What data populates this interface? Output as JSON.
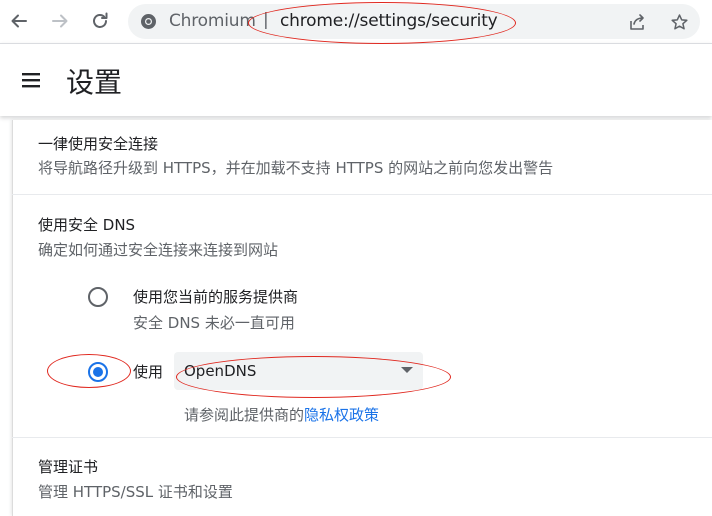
{
  "browser": {
    "origin_label": "Chromium",
    "separator": "|",
    "url": "chrome://settings/security",
    "icons": {
      "back": "arrow-left-icon",
      "forward": "arrow-right-icon",
      "reload": "reload-icon",
      "site": "chromium-site-icon",
      "share": "share-icon",
      "bookmark": "star-icon"
    }
  },
  "header": {
    "menu_icon": "hamburger-menu-icon",
    "title": "设置"
  },
  "sections": {
    "https": {
      "title": "一律使用安全连接",
      "subtitle": "将导航路径升级到 HTTPS，并在加载不支持 HTTPS 的网站之前向您发出警告"
    },
    "secure_dns": {
      "title": "使用安全 DNS",
      "subtitle": "确定如何通过安全连接来连接到网站",
      "option_current": {
        "label": "使用您当前的服务提供商",
        "sublabel": "安全 DNS 未必一直可用",
        "selected": false
      },
      "option_custom": {
        "label": "使用",
        "selected": true,
        "provider": "OpenDNS",
        "privacy_prefix": "请参阅此提供商的",
        "privacy_link": "隐私权政策"
      }
    },
    "certificates": {
      "title": "管理证书",
      "subtitle": "管理 HTTPS/SSL 证书和设置"
    }
  },
  "colors": {
    "accent": "#1a73e8",
    "annotation": "#e0281f",
    "omnibox_bg": "#f1f3f4"
  }
}
